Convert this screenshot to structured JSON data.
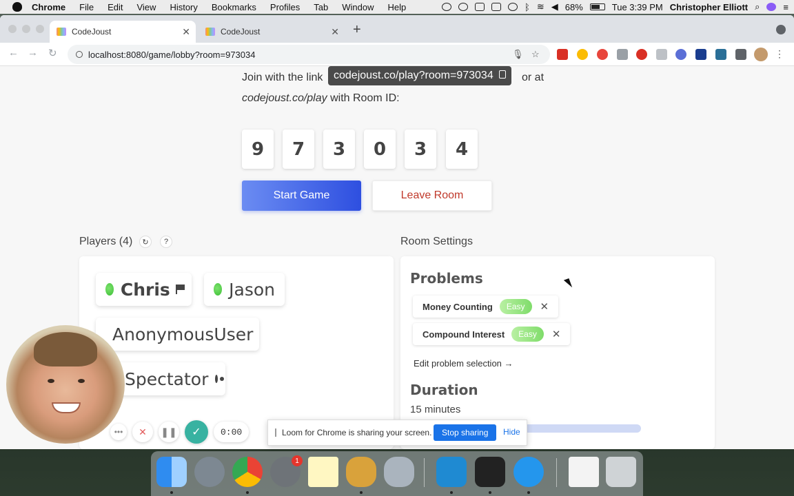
{
  "menubar": {
    "app": "Chrome",
    "items": [
      "File",
      "Edit",
      "View",
      "History",
      "Bookmarks",
      "Profiles",
      "Tab",
      "Window",
      "Help"
    ],
    "battery": "68%",
    "clock": "Tue 3:39 PM",
    "user": "Christopher Elliott"
  },
  "browser": {
    "tabs": [
      {
        "title": "CodeJoust",
        "active": true
      },
      {
        "title": "CodeJoust",
        "active": false
      }
    ],
    "url": "localhost:8080/game/lobby?room=973034"
  },
  "lobby": {
    "join_prefix": "Join with the link",
    "join_link": "codejoust.co/play?room=973034",
    "or_at": "or at",
    "play_url": "codejoust.co/play",
    "with_room_id": "with Room ID:",
    "room_digits": [
      "9",
      "7",
      "3",
      "0",
      "3",
      "4"
    ],
    "start_label": "Start Game",
    "leave_label": "Leave Room"
  },
  "players": {
    "title": "Players (4)",
    "list": [
      {
        "name": "Chris",
        "role": "host"
      },
      {
        "name": "Jason",
        "role": "player"
      },
      {
        "name": "AnonymousUser",
        "role": "player"
      },
      {
        "name": "Spectator",
        "role": "spectator"
      }
    ]
  },
  "settings": {
    "title": "Room Settings",
    "problems_heading": "Problems",
    "problems": [
      {
        "name": "Money Counting",
        "difficulty": "Easy"
      },
      {
        "name": "Compound Interest",
        "difficulty": "Easy"
      }
    ],
    "edit_link": "Edit problem selection →",
    "duration_heading": "Duration",
    "duration_value": "15 minutes"
  },
  "loom": {
    "timer": "0:00",
    "share_message": "Loom for Chrome is sharing your screen.",
    "stop_label": "Stop sharing",
    "hide_label": "Hide"
  },
  "dock": {
    "settings_badge": "1"
  },
  "colors": {
    "primary_blue": "#2e4fe0",
    "leave_red": "#c0392b",
    "online_green": "#3fbf38",
    "easy_green": "#7fdc6a",
    "loom_teal": "#38b2a1"
  }
}
